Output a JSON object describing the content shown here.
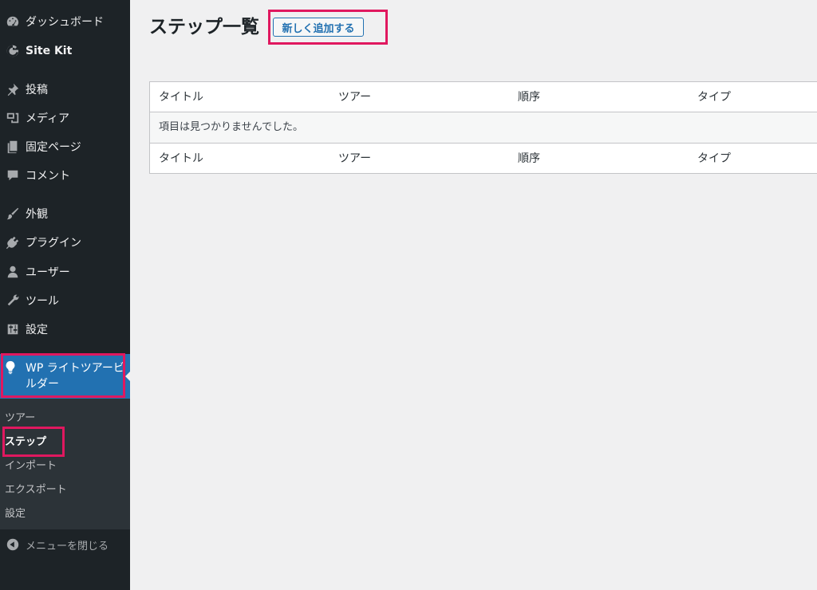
{
  "sidebar": {
    "items": [
      {
        "label": "ダッシュボード",
        "icon": "dashboard-icon"
      },
      {
        "label": "Site Kit",
        "icon": "google-icon"
      },
      {
        "label": "投稿",
        "icon": "pin-icon"
      },
      {
        "label": "メディア",
        "icon": "media-icon"
      },
      {
        "label": "固定ページ",
        "icon": "pages-icon"
      },
      {
        "label": "コメント",
        "icon": "comment-icon"
      },
      {
        "label": "外観",
        "icon": "brush-icon"
      },
      {
        "label": "プラグイン",
        "icon": "plugin-icon"
      },
      {
        "label": "ユーザー",
        "icon": "user-icon"
      },
      {
        "label": "ツール",
        "icon": "wrench-icon"
      },
      {
        "label": "設定",
        "icon": "settings-icon"
      }
    ],
    "active": {
      "label": "WP ライトツアービルダー",
      "icon": "lightbulb-icon"
    },
    "submenu": [
      "ツアー",
      "ステップ",
      "インポート",
      "エクスポート",
      "設定"
    ],
    "collapse_label": "メニューを閉じる"
  },
  "main": {
    "title": "ステップ一覧",
    "add_new_label": "新しく追加する",
    "table": {
      "columns": [
        "タイトル",
        "ツアー",
        "順序",
        "タイプ"
      ],
      "empty_message": "項目は見つかりませんでした。"
    }
  },
  "colors": {
    "sidebar_bg": "#1d2327",
    "accent": "#2271b1",
    "highlight": "#e0185f"
  }
}
